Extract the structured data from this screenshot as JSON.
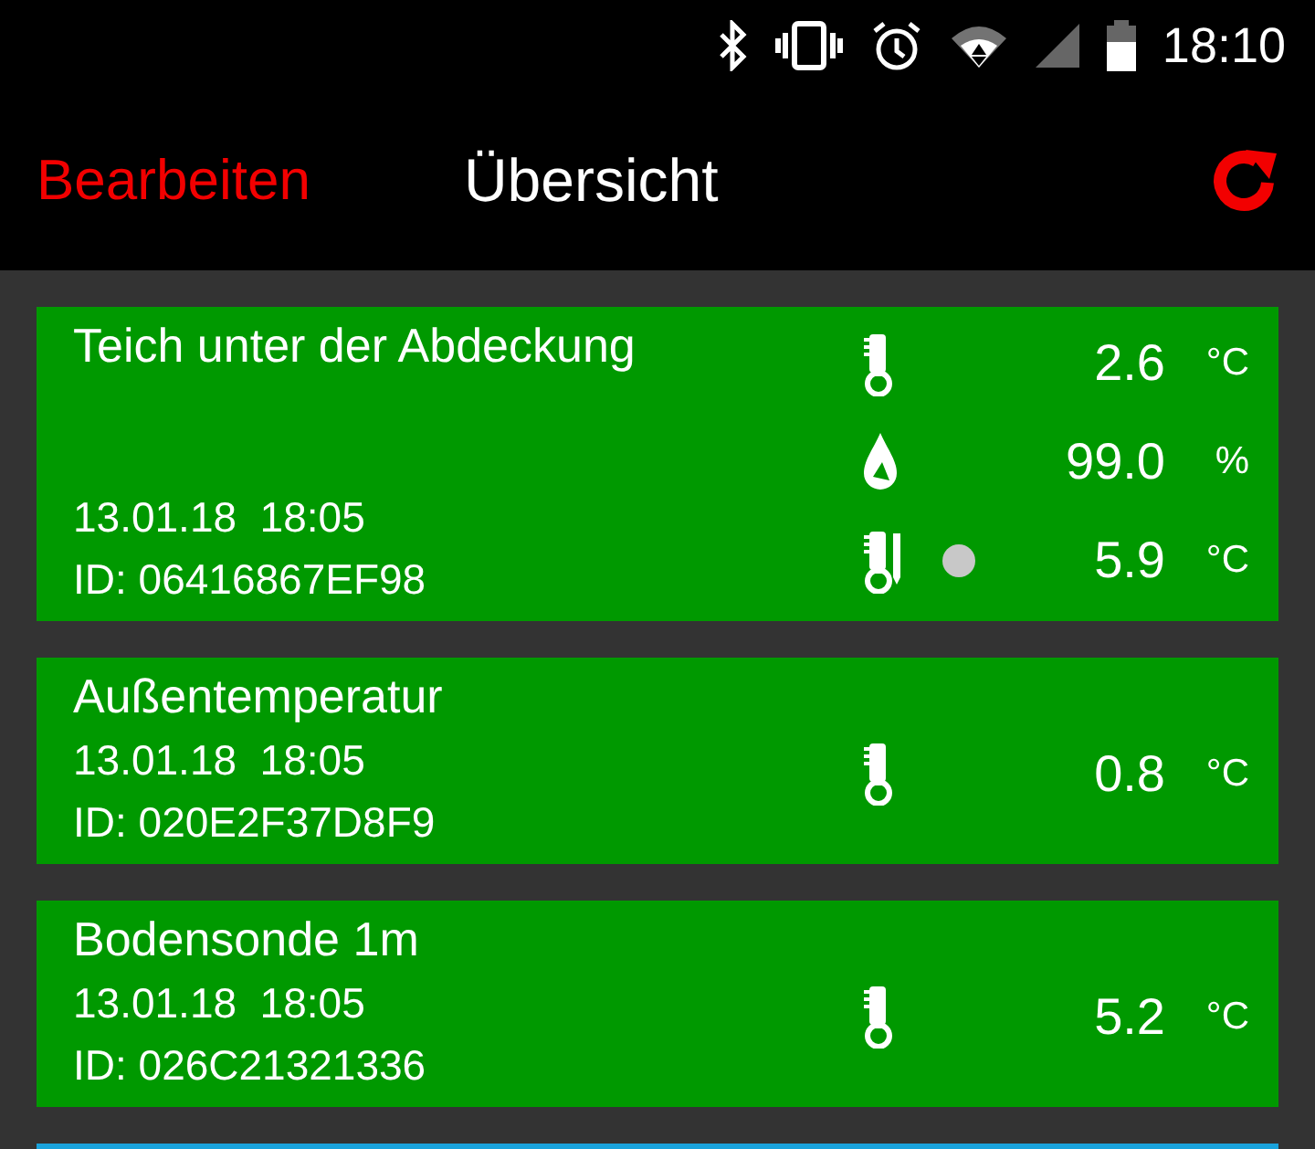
{
  "status_bar": {
    "time": "18:10"
  },
  "header": {
    "edit": "Bearbeiten",
    "title": "Übersicht"
  },
  "sensors": [
    {
      "name": "Teich unter der Abdeckung",
      "date": "13.01.18  18:05",
      "id": "ID: 06416867EF98",
      "color": "#009900",
      "readings": [
        {
          "kind": "thermometer",
          "value": "2.6",
          "unit": "°C",
          "dot": false
        },
        {
          "kind": "drop",
          "value": "99.0",
          "unit": "%",
          "dot": false
        },
        {
          "kind": "probe",
          "value": "5.9",
          "unit": "°C",
          "dot": true
        }
      ]
    },
    {
      "name": "Außentemperatur",
      "date": "13.01.18  18:05",
      "id": "ID: 020E2F37D8F9",
      "color": "#009900",
      "readings": [
        {
          "kind": "thermometer",
          "value": "0.8",
          "unit": "°C",
          "dot": false
        }
      ]
    },
    {
      "name": "Bodensonde 1m",
      "date": "13.01.18  18:05",
      "id": "ID: 026C21321336",
      "color": "#009900",
      "readings": [
        {
          "kind": "thermometer",
          "value": "5.2",
          "unit": "°C",
          "dot": false
        }
      ]
    },
    {
      "color": "#1aa3dc"
    }
  ]
}
